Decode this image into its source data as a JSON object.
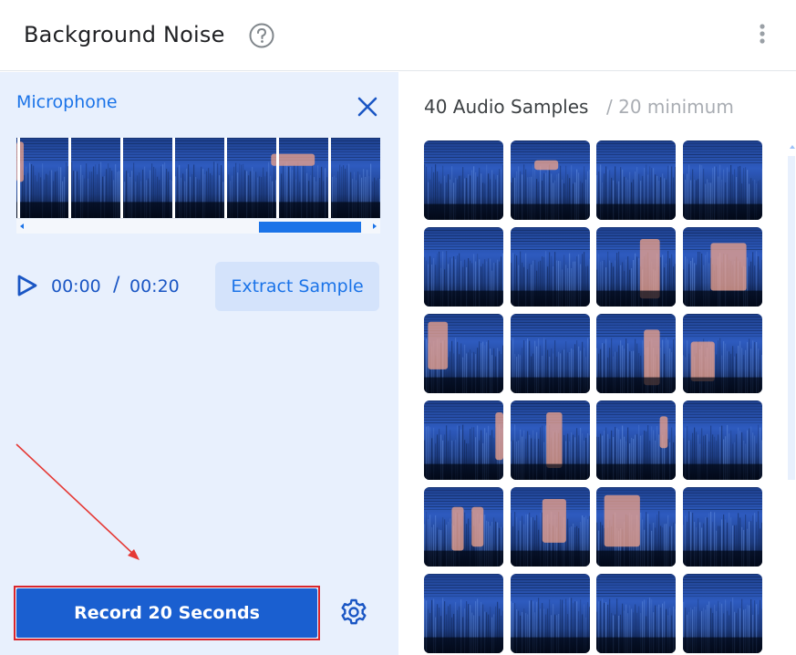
{
  "header": {
    "title": "Background Noise",
    "help_icon": "help-circle-icon",
    "menu_icon": "more-vert-icon"
  },
  "left_panel": {
    "section_label": "Microphone",
    "close_icon": "close-icon",
    "waveform": {
      "frames": 7,
      "scroll_position": 0.67
    },
    "player": {
      "play_icon": "play-icon",
      "current_time": "00:00",
      "separator": "/",
      "total_time": "00:20"
    },
    "extract_button": "Extract Sample",
    "record_button": "Record 20 Seconds",
    "settings_icon": "gear-icon"
  },
  "right_panel": {
    "samples_label": "40 Audio Samples",
    "minimum_label": "/ 20 minimum",
    "grid": {
      "columns": 4,
      "rows_visible": 6
    }
  },
  "colors": {
    "accent": "#1a73e8",
    "record_button": "#1a5fd0",
    "panel_bg": "#e8f0fd",
    "annotation_red": "#d9262c",
    "spectrogram_dark": "#0b1d44",
    "spectrogram_blue": "#3d6fd4",
    "spectrogram_hot": "#f0a38a"
  }
}
